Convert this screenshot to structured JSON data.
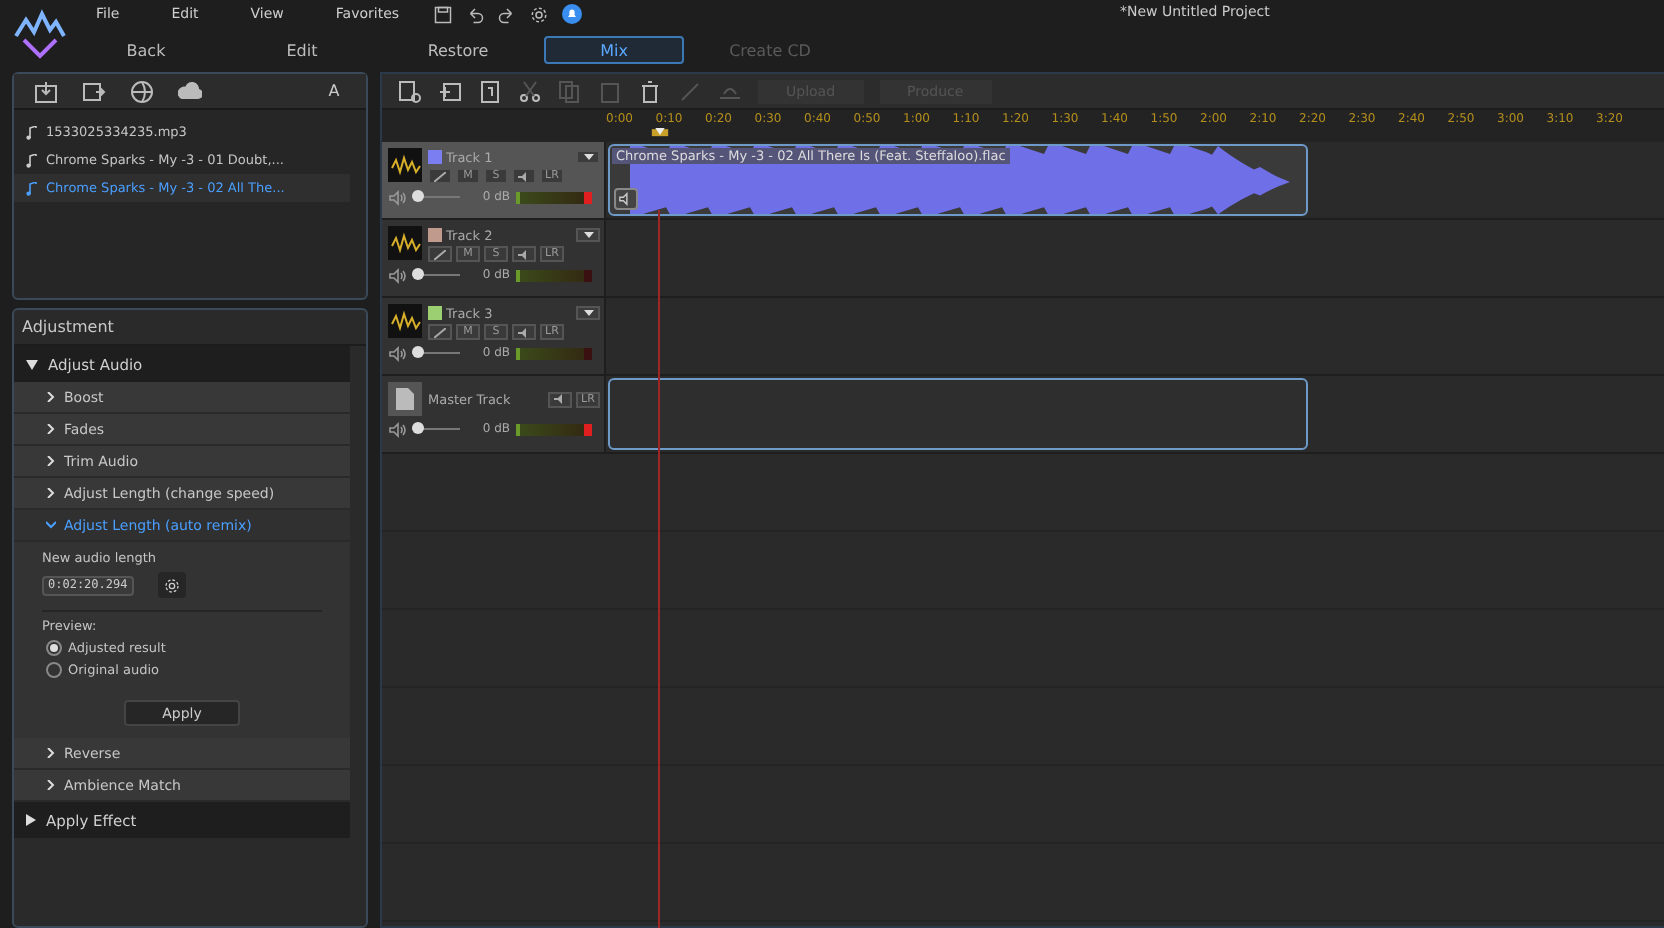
{
  "menu": [
    "File",
    "Edit",
    "View",
    "Favorites"
  ],
  "title": "*New Untitled Project",
  "nav": [
    {
      "label": "Back",
      "selected": false,
      "disabled": false
    },
    {
      "label": "Edit",
      "selected": false,
      "disabled": false
    },
    {
      "label": "Restore",
      "selected": false,
      "disabled": false
    },
    {
      "label": "Mix",
      "selected": true,
      "disabled": false
    },
    {
      "label": "Create CD",
      "selected": false,
      "disabled": true
    }
  ],
  "library": {
    "font_button": "A",
    "items": [
      {
        "name": "1533025334235.mp3",
        "selected": false
      },
      {
        "name": "Chrome Sparks - My -3 - 01 Doubt,...",
        "selected": false
      },
      {
        "name": "Chrome Sparks - My -3 - 02 All The...",
        "selected": true
      }
    ]
  },
  "adjustment": {
    "title": "Adjustment",
    "group": "Adjust Audio",
    "items": [
      {
        "label": "Boost",
        "expanded": false
      },
      {
        "label": "Fades",
        "expanded": false
      },
      {
        "label": "Trim Audio",
        "expanded": false
      },
      {
        "label": "Adjust Length (change speed)",
        "expanded": false
      },
      {
        "label": "Adjust Length (auto remix)",
        "expanded": true
      },
      {
        "label": "Reverse",
        "expanded": false
      },
      {
        "label": "Ambience Match",
        "expanded": false
      }
    ],
    "length_label": "New audio length",
    "length_value": "0:02:20.294",
    "preview_label": "Preview:",
    "preview_options": [
      {
        "label": "Adjusted result",
        "selected": true
      },
      {
        "label": "Original audio",
        "selected": false
      }
    ],
    "apply": "Apply",
    "effect_group": "Apply Effect"
  },
  "toolbar": {
    "upload": "Upload",
    "produce": "Produce"
  },
  "ruler": [
    "0:00",
    "0:10",
    "0:20",
    "0:30",
    "0:40",
    "0:50",
    "1:00",
    "1:10",
    "1:20",
    "1:30",
    "1:40",
    "1:50",
    "2:00",
    "2:10",
    "2:20",
    "2:30",
    "2:40",
    "2:50",
    "3:00",
    "3:10",
    "3:20"
  ],
  "tracks": [
    {
      "kind": "track",
      "name": "Track 1",
      "color": "#7b7ef0",
      "selected": true,
      "volume": "0 dB",
      "clipping": true,
      "mute": "M",
      "solo": "S",
      "pan": "LR"
    },
    {
      "kind": "track",
      "name": "Track 2",
      "color": "#c09a8c",
      "selected": false,
      "volume": "0 dB",
      "clipping": false,
      "mute": "M",
      "solo": "S",
      "pan": "LR"
    },
    {
      "kind": "track",
      "name": "Track 3",
      "color": "#9ccf72",
      "selected": false,
      "volume": "0 dB",
      "clipping": false,
      "mute": "M",
      "solo": "S",
      "pan": "LR"
    },
    {
      "kind": "master",
      "name": "Master Track",
      "selected": false,
      "volume": "0 dB",
      "clipping": true,
      "pan": "LR"
    }
  ],
  "clip": {
    "title": "Chrome Sparks - My -3 - 02 All There Is (Feat. Steffaloo).flac"
  }
}
